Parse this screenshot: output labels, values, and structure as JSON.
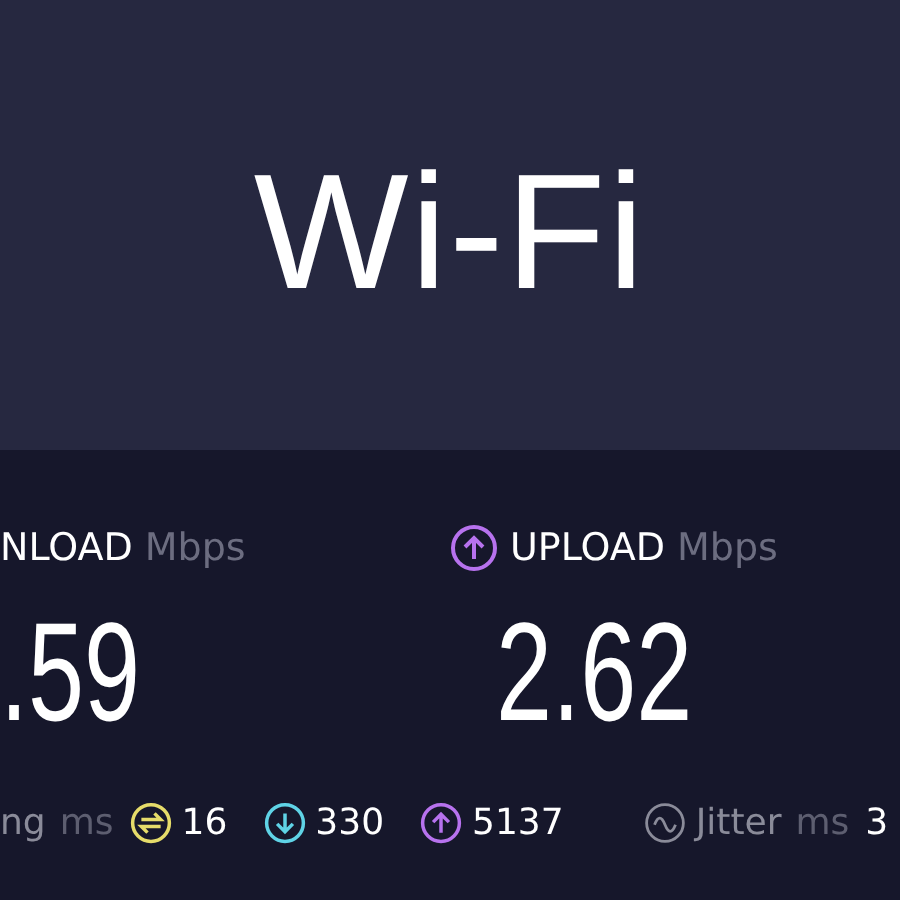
{
  "title": "Wi-Fi",
  "results": [
    {
      "kind": "download",
      "icon": false,
      "label": "NLOAD",
      "unit": "Mbps",
      "value": ".59"
    },
    {
      "kind": "upload",
      "icon": true,
      "label": "UPLOAD",
      "unit": "Mbps",
      "value": "2.62"
    }
  ],
  "ping": {
    "label": "ng",
    "unit": "ms",
    "stats": [
      {
        "kind": "idle",
        "value": "16"
      },
      {
        "kind": "download",
        "value": "330"
      },
      {
        "kind": "upload",
        "value": "5137"
      }
    ]
  },
  "jitter": {
    "label": "Jitter",
    "unit": "ms",
    "value": "3"
  }
}
